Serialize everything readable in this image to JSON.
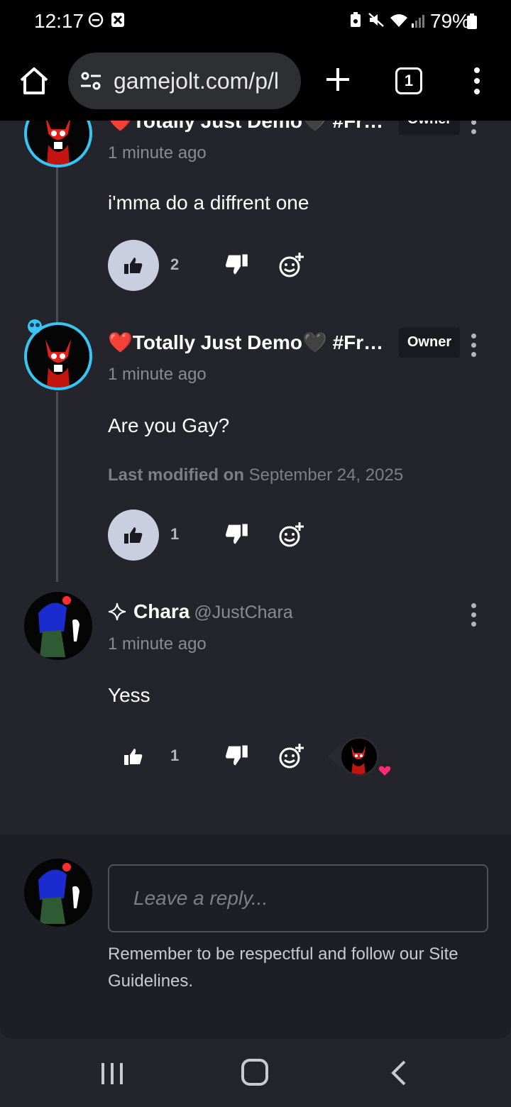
{
  "status_bar": {
    "time": "12:17",
    "battery": "79%"
  },
  "browser": {
    "url": "gamejolt.com/p/l",
    "tab_count": "1"
  },
  "comments": [
    {
      "username": "❤️Totally Just Demo🖤 #Fr…",
      "badge": "Owner",
      "timestamp": "1 minute ago",
      "text": "i'mma do a diffrent one",
      "like_count": "2",
      "liked": true
    },
    {
      "username": "❤️Totally Just Demo🖤 #Fr…",
      "badge": "Owner",
      "timestamp": "1 minute ago",
      "text": "Are you Gay?",
      "modified_label": "Last modified on",
      "modified_date": "September 24, 2025",
      "like_count": "1",
      "liked": true
    },
    {
      "username": "Chara",
      "handle": "@JustChara",
      "timestamp": "1 minute ago",
      "text": "Yess",
      "like_count": "1",
      "liked": false
    }
  ],
  "reply": {
    "placeholder": "Leave a reply...",
    "guideline": "Remember to be respectful and follow our Site Guidelines."
  },
  "colors": {
    "background": "#23242c",
    "accent_ring": "#37c6f4",
    "like_active": "#c9cfe0",
    "heart": "#ff2d6f"
  }
}
